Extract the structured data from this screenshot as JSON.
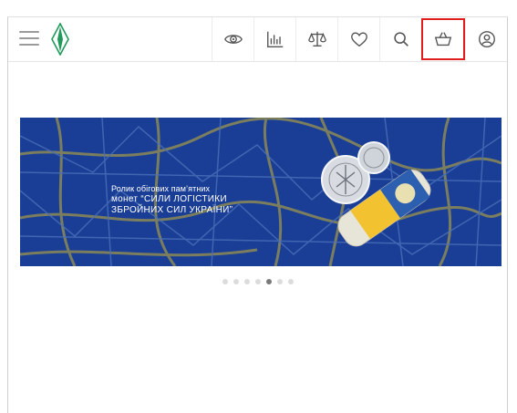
{
  "header": {
    "logo_icon": "leaf-diamond-logo",
    "menu_icon": "hamburger-menu-icon",
    "icons": [
      {
        "name": "eye-icon",
        "label": "viewed"
      },
      {
        "name": "bar-chart-icon",
        "label": "statistics"
      },
      {
        "name": "scales-icon",
        "label": "compare"
      },
      {
        "name": "heart-icon",
        "label": "favorites"
      },
      {
        "name": "search-icon",
        "label": "search"
      },
      {
        "name": "basket-icon",
        "label": "cart"
      },
      {
        "name": "user-icon",
        "label": "account"
      }
    ],
    "highlight_color": "#e11d1d",
    "logo_color": "#1f9a5a"
  },
  "banner": {
    "line1": "Ролик обігових пам’ятних",
    "line2": "монет “СИЛИ ЛОГІСТИКИ",
    "line3": "ЗБРОЙНИХ СИЛ УКРАЇНИ”",
    "background": "#1a3e95",
    "accent": "#f2c230"
  },
  "carousel": {
    "slide_count": 7,
    "active_index": 4
  }
}
